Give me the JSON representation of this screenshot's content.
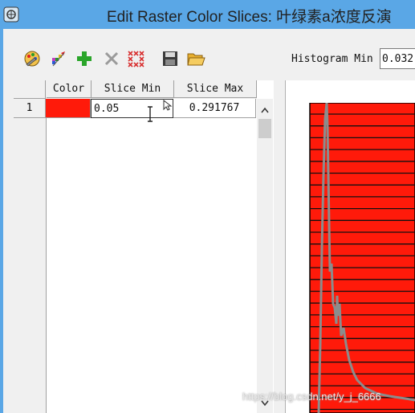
{
  "window": {
    "title": "Edit Raster Color Slices: 叶绿素a浓度反演"
  },
  "toolbar": {
    "buttons": [
      {
        "name": "color-palette-icon"
      },
      {
        "name": "auto-slices-icon"
      },
      {
        "name": "add-icon"
      },
      {
        "name": "delete-icon"
      },
      {
        "name": "clear-all-icon"
      },
      {
        "name": "save-icon"
      },
      {
        "name": "open-folder-icon"
      }
    ],
    "histogram_min_label": "Histogram Min",
    "histogram_min_value": "0.032"
  },
  "grid": {
    "columns": [
      "Color",
      "Slice Min",
      "Slice Max"
    ],
    "rows": [
      {
        "index": "1",
        "color": "#ff1a0a",
        "slice_min": "0.05",
        "slice_max": "0.291767"
      }
    ]
  },
  "histogram": {
    "fill_color": "#ff1a0a",
    "line_color": "#8c8c8c",
    "stripe_color": "#111111"
  },
  "watermark": "https://blog.csdn.net/y_j_6666"
}
